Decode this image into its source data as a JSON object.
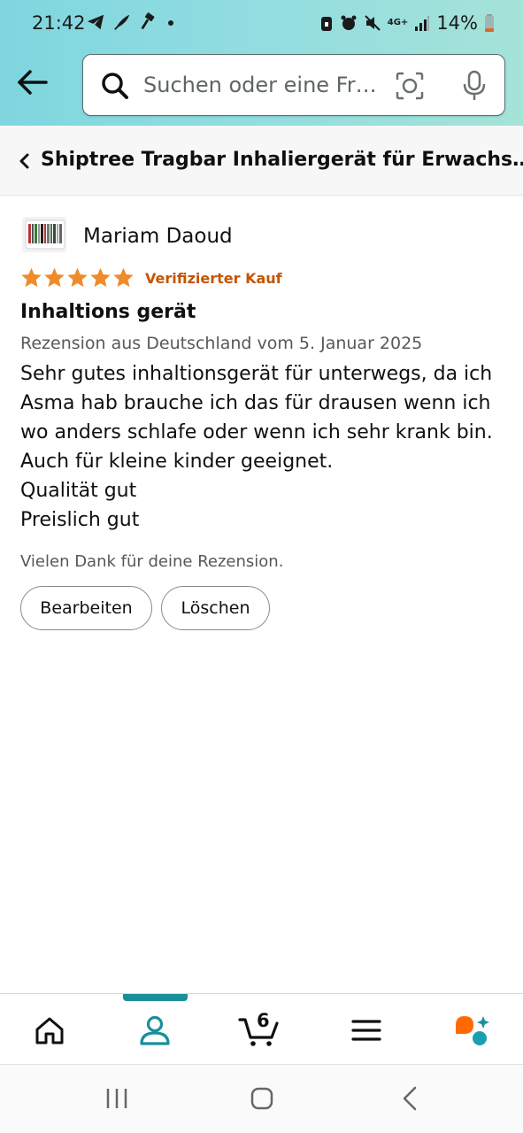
{
  "status_bar": {
    "time": "21:42",
    "battery_percent": "14%",
    "network": "4G+"
  },
  "header": {
    "back_icon": "arrow-left-icon",
    "search_placeholder": "Suchen oder eine Fr…",
    "icons": [
      "search-icon",
      "camera-lens-icon",
      "microphone-icon"
    ]
  },
  "breadcrumb": {
    "title": "Shiptree Tragbar Inhaliergerät für Erwachs…"
  },
  "review": {
    "reviewer_name": "Mariam Daoud",
    "rating": 5,
    "rating_max": 5,
    "verified_label": "Verifizierter Kauf",
    "title": "Inhaltions gerät",
    "date_line": "Rezension aus Deutschland vom 5. Januar 2025",
    "body_lines": [
      "Sehr gutes inhaltionsgerät für unterwegs, da ich",
      "Asma hab brauche ich das für drausen wenn ich",
      "wo anders schlafe oder wenn ich sehr krank bin.",
      "Auch für kleine kinder geeignet.",
      "Qualität gut",
      "Preislich gut"
    ],
    "thanks": "Vielen Dank für deine Rezension.",
    "edit_label": "Bearbeiten",
    "delete_label": "Löschen"
  },
  "bottom_nav": {
    "items": [
      "home-icon",
      "account-icon",
      "cart-icon",
      "menu-icon",
      "rufus-icon"
    ],
    "active": "account-icon",
    "cart_count": "6"
  },
  "colors": {
    "header_teal": "#92dde0",
    "star": "#ee8b2a",
    "verified": "#c45500",
    "active_indicator": "#1a8f9c"
  }
}
